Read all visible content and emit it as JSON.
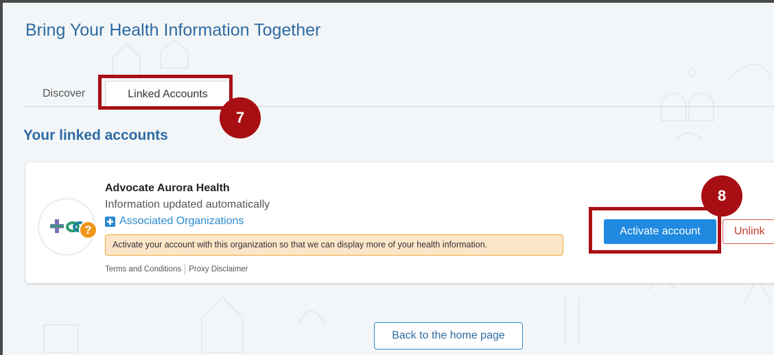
{
  "page": {
    "title": "Bring Your Health Information Together"
  },
  "tabs": [
    {
      "label": "Discover",
      "active": false
    },
    {
      "label": "Linked Accounts",
      "active": true
    }
  ],
  "callouts": {
    "tab": "7",
    "button": "8"
  },
  "section": {
    "title": "Your linked accounts"
  },
  "account": {
    "name": "Advocate Aurora Health",
    "status": "Information updated automatically",
    "associated_link": "Associated Organizations",
    "notice": "Activate your account with this organization so that we can display more of your health information.",
    "terms_link": "Terms and Conditions",
    "proxy_link": "Proxy Disclaimer",
    "badge": "?",
    "logo_icon": "advocate-aurora-logo-icon"
  },
  "buttons": {
    "activate": "Activate account",
    "unlink": "Unlink",
    "home": "Back to the home page"
  },
  "colors": {
    "title_blue": "#2d6aa3",
    "button_blue": "#1f8ae0",
    "highlight_red": "#a80f14",
    "notice_bg": "#fde5c8",
    "notice_border": "#f0a73a",
    "badge_orange": "#f0961b"
  }
}
